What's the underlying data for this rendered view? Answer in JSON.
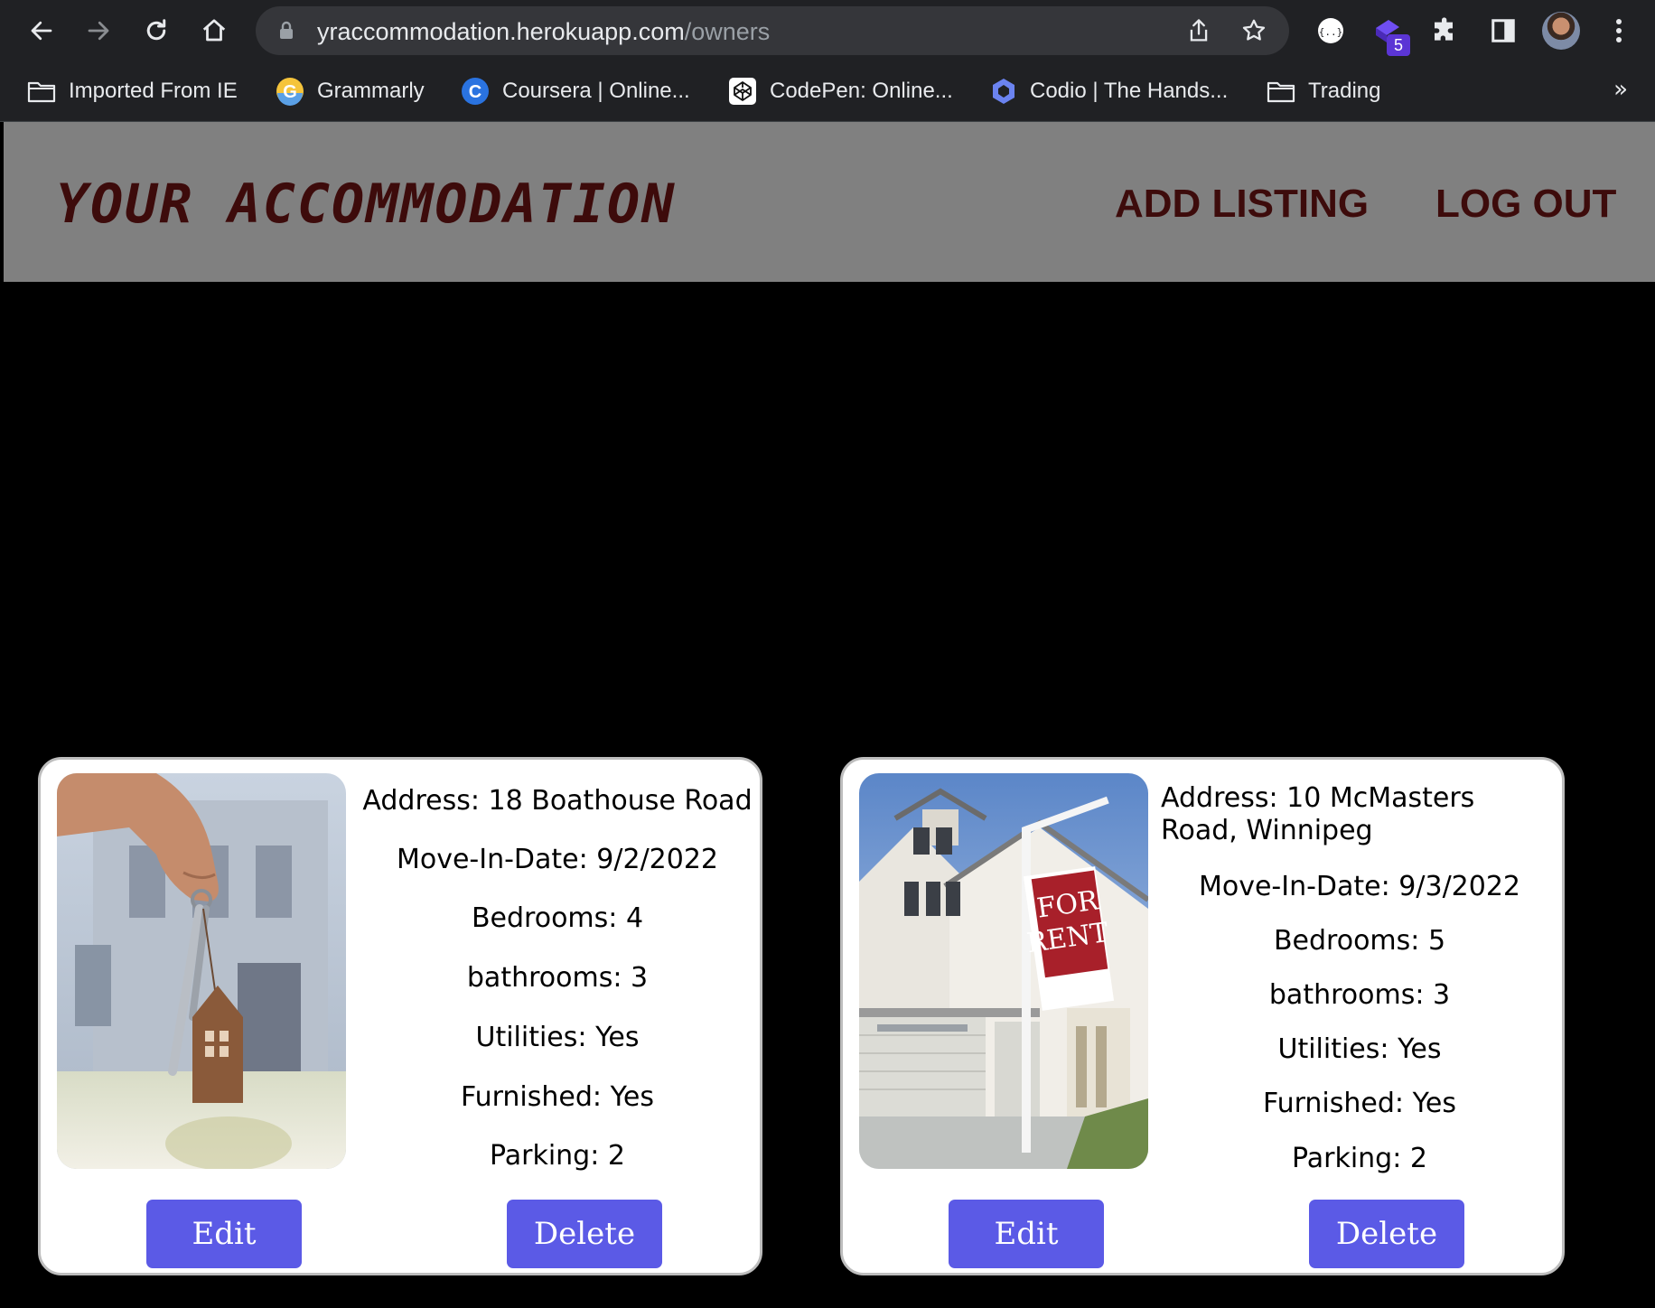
{
  "browser": {
    "url_host": "yraccommodation.herokuapp.com",
    "url_path": "/owners",
    "extension_badge": "5",
    "bookmarks": [
      {
        "label": "Imported From IE",
        "icon": "folder-icon"
      },
      {
        "label": "Grammarly",
        "icon": "grammarly-icon"
      },
      {
        "label": "Coursera | Online...",
        "icon": "coursera-icon"
      },
      {
        "label": "CodePen: Online...",
        "icon": "codepen-icon"
      },
      {
        "label": "Codio | The Hands...",
        "icon": "codio-icon"
      },
      {
        "label": "Trading",
        "icon": "folder-icon"
      }
    ],
    "bookmarks_overflow": "»"
  },
  "header": {
    "title": "YOUR ACCOMMODATION",
    "nav": {
      "add_listing": "ADD LISTING",
      "log_out": "LOG OUT"
    }
  },
  "listings": [
    {
      "address_label": "Address:",
      "address": "18 Boathouse Road",
      "move_in_label": "Move-In-Date:",
      "move_in": "9/2/2022",
      "bedrooms_label": "Bedrooms:",
      "bedrooms": "4",
      "bathrooms_label": "bathrooms:",
      "bathrooms": "3",
      "utilities_label": "Utilities:",
      "utilities": "Yes",
      "furnished_label": "Furnished:",
      "furnished": "Yes",
      "parking_label": "Parking:",
      "parking": "2",
      "edit_label": "Edit",
      "delete_label": "Delete"
    },
    {
      "address_label": "Address:",
      "address_line1": "10 McMasters",
      "address_line2": "Road, Winnipeg",
      "move_in_label": "Move-In-Date:",
      "move_in": "9/3/2022",
      "bedrooms_label": "Bedrooms:",
      "bedrooms": "5",
      "bathrooms_label": "bathrooms:",
      "bathrooms": "3",
      "utilities_label": "Utilities:",
      "utilities": "Yes",
      "furnished_label": "Furnished:",
      "furnished": "Yes",
      "parking_label": "Parking:",
      "parking": "2",
      "edit_label": "Edit",
      "delete_label": "Delete",
      "sign_text": [
        "FOR",
        "RENT"
      ]
    }
  ],
  "colors": {
    "header_bg": "#808080",
    "title": "#3d0b0b",
    "button": "#5b5ae6",
    "page_bg": "#000000"
  }
}
